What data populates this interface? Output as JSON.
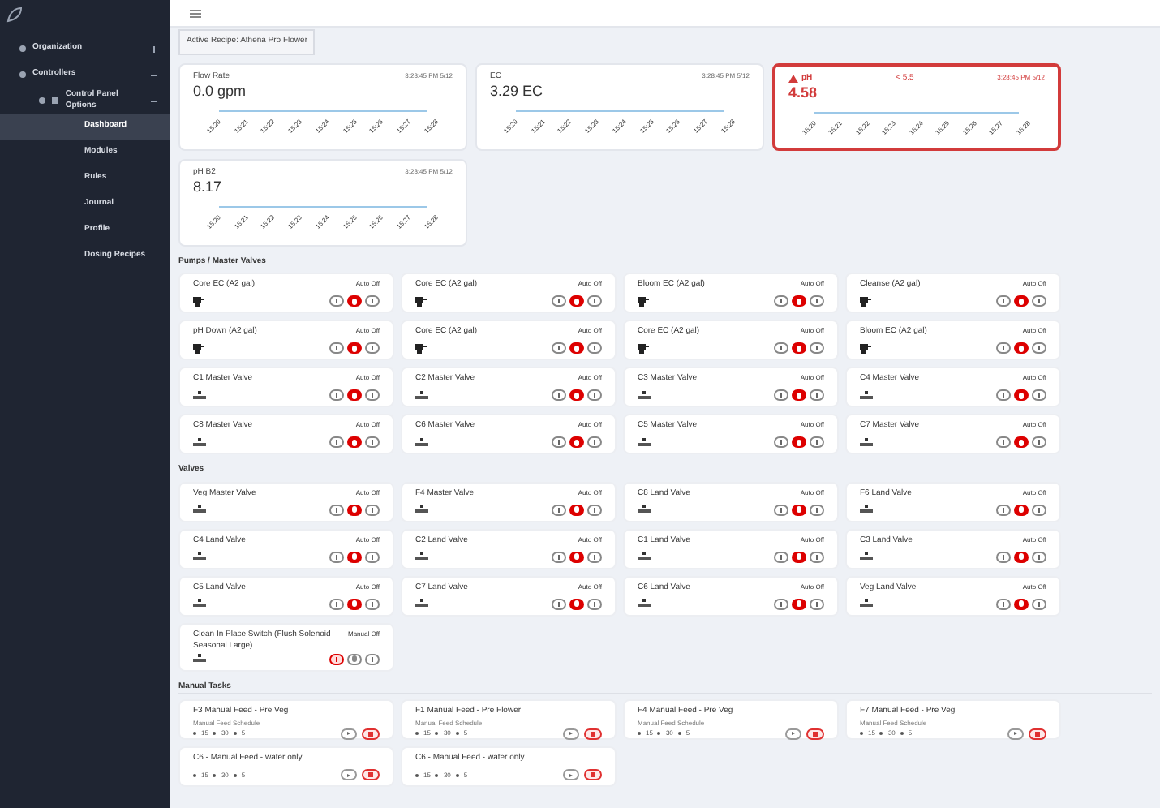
{
  "sidebar": {
    "items": [
      {
        "label": "Organization",
        "expanded": false
      },
      {
        "label": "Controllers",
        "expanded": true,
        "children": [
          {
            "label": "Control Panel Options",
            "expanded": true,
            "children": [
              {
                "label": "Dashboard",
                "selected": true
              },
              {
                "label": "Modules",
                "selected": false
              },
              {
                "label": "Rules",
                "selected": false
              },
              {
                "label": "Journal",
                "selected": false
              },
              {
                "label": "Profile",
                "selected": false
              },
              {
                "label": "Dosing Recipes",
                "selected": false
              }
            ]
          }
        ]
      }
    ]
  },
  "active_recipe": "Active Recipe: Athena Pro Flower",
  "sensors": [
    {
      "name": "Flow Rate",
      "value": "0.0 gpm",
      "time": "3:28:45 PM 5/12",
      "alert": false,
      "ticks": [
        "15:20",
        "15:21",
        "15:22",
        "15:23",
        "15:24",
        "15:25",
        "15:26",
        "15:27",
        "15:28"
      ]
    },
    {
      "name": "EC",
      "value": "3.29 EC",
      "time": "3:28:45 PM 5/12",
      "alert": false,
      "ticks": [
        "15:20",
        "15:21",
        "15:22",
        "15:23",
        "15:24",
        "15:25",
        "15:26",
        "15:27",
        "15:28"
      ]
    },
    {
      "name": "pH",
      "value": "4.58",
      "time": "3:28:45 PM 5/12",
      "alert": true,
      "limit": "< 5.5",
      "ticks": [
        "15:20",
        "15:21",
        "15:22",
        "15:23",
        "15:24",
        "15:25",
        "15:26",
        "15:27",
        "15:28"
      ]
    },
    {
      "name": "pH B2",
      "value": "8.17",
      "time": "3:28:45 PM 5/12",
      "alert": false,
      "ticks": [
        "15:20",
        "15:21",
        "15:22",
        "15:23",
        "15:24",
        "15:25",
        "15:26",
        "15:27",
        "15:28"
      ]
    }
  ],
  "sections": [
    {
      "title": "Pumps / Master Valves",
      "devices": [
        {
          "name": "Core EC (A2 gal)",
          "status": "Auto Off",
          "kind": "pump",
          "manual": false
        },
        {
          "name": "Core EC (A2 gal)",
          "status": "Auto Off",
          "kind": "pump",
          "manual": false
        },
        {
          "name": "Bloom EC (A2 gal)",
          "status": "Auto Off",
          "kind": "pump",
          "manual": false
        },
        {
          "name": "Cleanse (A2 gal)",
          "status": "Auto Off",
          "kind": "pump",
          "manual": false
        },
        {
          "name": "pH Down (A2 gal)",
          "status": "Auto Off",
          "kind": "pump",
          "manual": false
        },
        {
          "name": "Core EC (A2 gal)",
          "status": "Auto Off",
          "kind": "pump",
          "manual": false
        },
        {
          "name": "Core EC (A2 gal)",
          "status": "Auto Off",
          "kind": "pump",
          "manual": false
        },
        {
          "name": "Bloom EC (A2 gal)",
          "status": "Auto Off",
          "kind": "pump",
          "manual": false
        },
        {
          "name": "C1 Master Valve",
          "status": "Auto Off",
          "kind": "valve",
          "manual": false
        },
        {
          "name": "C2 Master Valve",
          "status": "Auto Off",
          "kind": "valve",
          "manual": false
        },
        {
          "name": "C3 Master Valve",
          "status": "Auto Off",
          "kind": "valve",
          "manual": false
        },
        {
          "name": "C4 Master Valve",
          "status": "Auto Off",
          "kind": "valve",
          "manual": false
        },
        {
          "name": "C8 Master Valve",
          "status": "Auto Off",
          "kind": "valve",
          "manual": false
        },
        {
          "name": "C6 Master Valve",
          "status": "Auto Off",
          "kind": "valve",
          "manual": false
        },
        {
          "name": "C5 Master Valve",
          "status": "Auto Off",
          "kind": "valve",
          "manual": false
        },
        {
          "name": "C7 Master Valve",
          "status": "Auto Off",
          "kind": "valve",
          "manual": false
        }
      ]
    },
    {
      "title": "Valves",
      "devices": [
        {
          "name": "Veg Master Valve",
          "status": "Auto Off",
          "kind": "valve",
          "manual": false
        },
        {
          "name": "F4 Master Valve",
          "status": "Auto Off",
          "kind": "valve",
          "manual": false
        },
        {
          "name": "C8 Land Valve",
          "status": "Auto Off",
          "kind": "valve",
          "manual": false
        },
        {
          "name": "F6 Land Valve",
          "status": "Auto Off",
          "kind": "valve",
          "manual": false
        },
        {
          "name": "C4 Land Valve",
          "status": "Auto Off",
          "kind": "valve",
          "manual": false
        },
        {
          "name": "C2 Land Valve",
          "status": "Auto Off",
          "kind": "valve",
          "manual": false
        },
        {
          "name": "C1 Land Valve",
          "status": "Auto Off",
          "kind": "valve",
          "manual": false
        },
        {
          "name": "C3 Land Valve",
          "status": "Auto Off",
          "kind": "valve",
          "manual": false
        },
        {
          "name": "C5 Land Valve",
          "status": "Auto Off",
          "kind": "valve",
          "manual": false
        },
        {
          "name": "C7 Land Valve",
          "status": "Auto Off",
          "kind": "valve",
          "manual": false
        },
        {
          "name": "C6 Land Valve",
          "status": "Auto Off",
          "kind": "valve",
          "manual": false
        },
        {
          "name": "Veg Land Valve",
          "status": "Auto Off",
          "kind": "valve",
          "manual": false
        },
        {
          "name": "Clean In Place Switch (Flush Solenoid Seasonal Large)",
          "status": "Manual Off",
          "kind": "valve",
          "manual": true
        }
      ]
    }
  ],
  "manual_tasks": {
    "title": "Manual Tasks",
    "tasks": [
      {
        "name": "F3 Manual Feed - Pre Veg",
        "subtitle": "Manual Feed Schedule",
        "steps": [
          "15",
          "30",
          "5"
        ]
      },
      {
        "name": "F1 Manual Feed - Pre Flower",
        "subtitle": "Manual Feed Schedule",
        "steps": [
          "15",
          "30",
          "5"
        ]
      },
      {
        "name": "F4 Manual Feed - Pre Veg",
        "subtitle": "Manual Feed Schedule",
        "steps": [
          "15",
          "30",
          "5"
        ]
      },
      {
        "name": "F7 Manual Feed - Pre Veg",
        "subtitle": "Manual Feed Schedule",
        "steps": [
          "15",
          "30",
          "5"
        ]
      },
      {
        "name": "C6 - Manual Feed - water only",
        "steps": [
          "15",
          "30",
          "5"
        ]
      },
      {
        "name": "C6 - Manual Feed - water only",
        "steps": [
          "15",
          "30",
          "5"
        ]
      }
    ]
  }
}
